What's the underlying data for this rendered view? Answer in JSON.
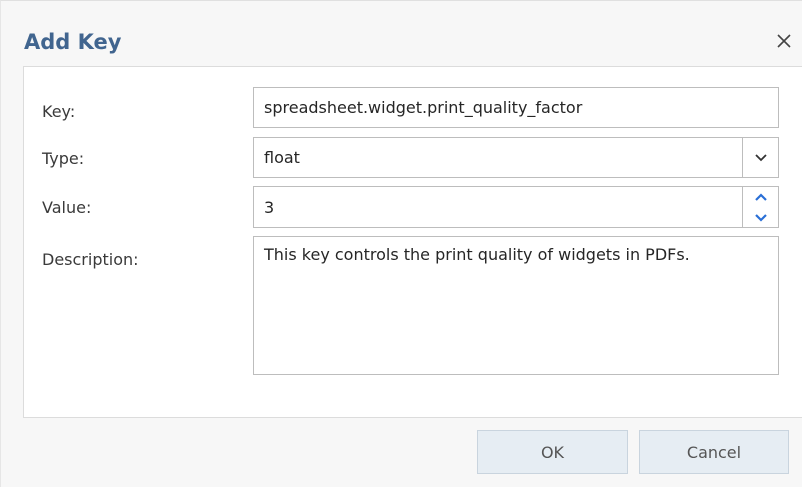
{
  "dialog": {
    "title": "Add Key",
    "close_icon": "close-icon"
  },
  "form": {
    "key_label": "Key:",
    "key_value": "spreadsheet.widget.print_quality_factor",
    "type_label": "Type:",
    "type_value": "float",
    "value_label": "Value:",
    "value_value": "3",
    "description_label": "Description:",
    "description_value": "This key controls the print quality of widgets in PDFs."
  },
  "buttons": {
    "ok_label": "OK",
    "cancel_label": "Cancel"
  },
  "colors": {
    "title": "#41658f",
    "accent_spinner": "#2a6fd6",
    "button_bg": "#e6edf3"
  }
}
